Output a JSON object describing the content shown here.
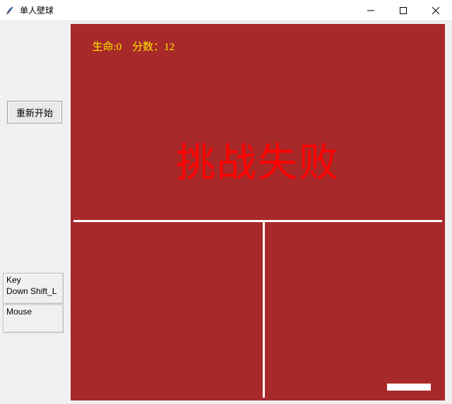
{
  "window": {
    "title": "单人壁球",
    "icon_name": "tk-feather-icon"
  },
  "controls": {
    "minimize_tooltip": "Minimize",
    "maximize_tooltip": "Maximize",
    "close_tooltip": "Close"
  },
  "sidebar": {
    "restart_label": "重新开始"
  },
  "debug": {
    "key_header": "Key",
    "key_value": "Down Shift_L",
    "mouse_header": "Mouse",
    "mouse_value": ""
  },
  "game": {
    "hud_lives_label": "生命:",
    "hud_lives_value": "0",
    "hud_score_label": "分数：",
    "hud_score_value": "12",
    "game_over_text": "挑战失败",
    "colors": {
      "canvas_bg": "#a82929",
      "hud_text": "#ffea00",
      "game_over_text": "#ff0000",
      "line": "#ffffff",
      "paddle": "#ffffff"
    }
  }
}
